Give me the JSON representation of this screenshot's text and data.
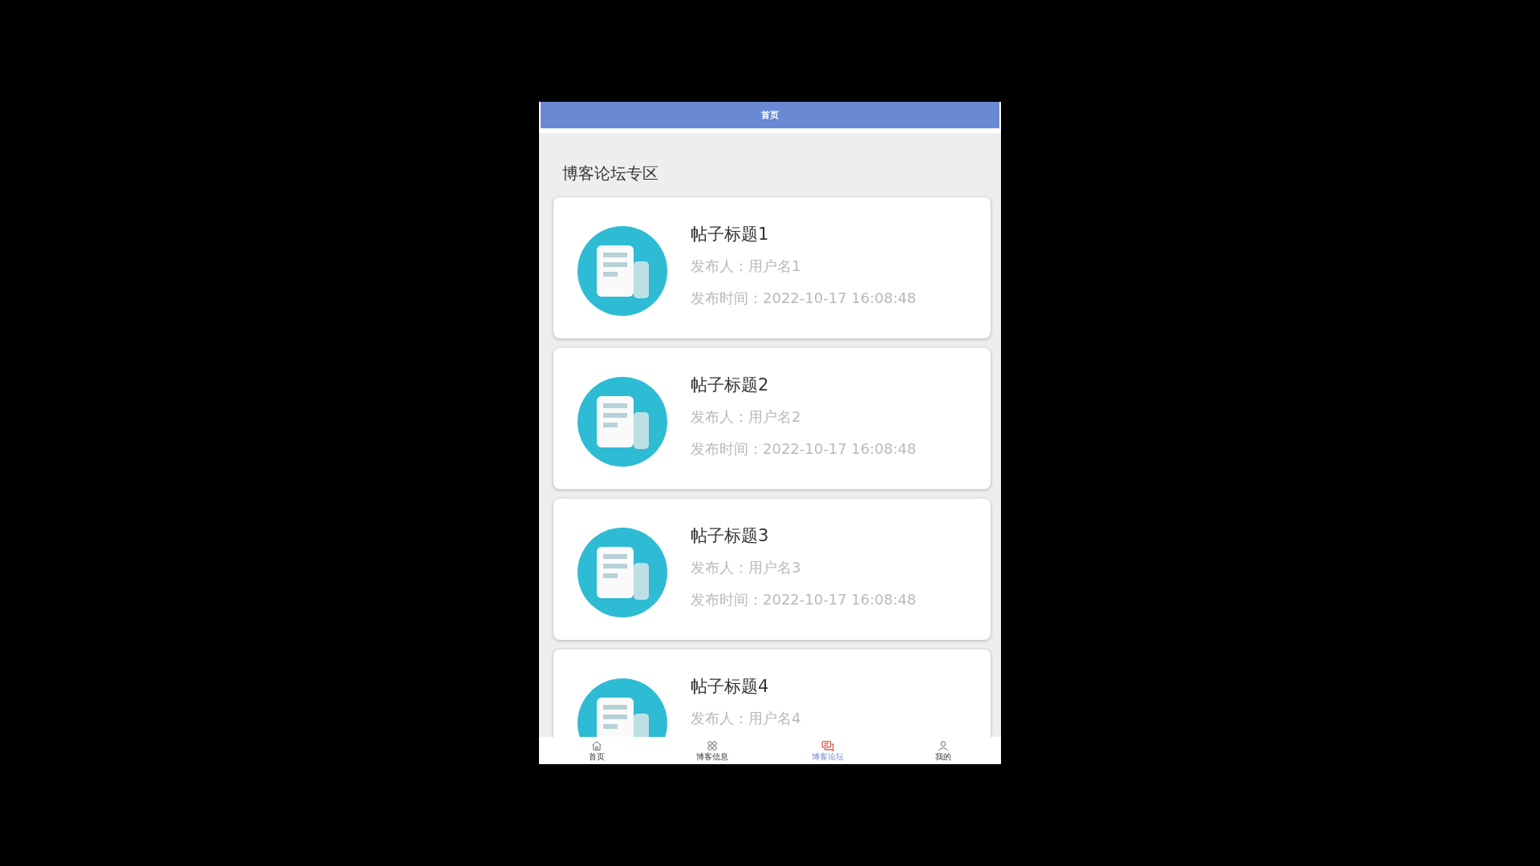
{
  "header": {
    "title": "首页"
  },
  "section_title": "博客论坛专区",
  "posts": [
    {
      "title": "帖子标题1",
      "author": "发布人：用户名1",
      "time": "发布时间：2022-10-17 16:08:48"
    },
    {
      "title": "帖子标题2",
      "author": "发布人：用户名2",
      "time": "发布时间：2022-10-17 16:08:48"
    },
    {
      "title": "帖子标题3",
      "author": "发布人：用户名3",
      "time": "发布时间：2022-10-17 16:08:48"
    },
    {
      "title": "帖子标题4",
      "author": "发布人：用户名4"
    }
  ],
  "tab_bar": [
    {
      "label": "首页",
      "selected": false
    },
    {
      "label": "博客信息",
      "selected": false
    },
    {
      "label": "博客论坛",
      "selected": true
    },
    {
      "label": "我的",
      "selected": false
    }
  ]
}
